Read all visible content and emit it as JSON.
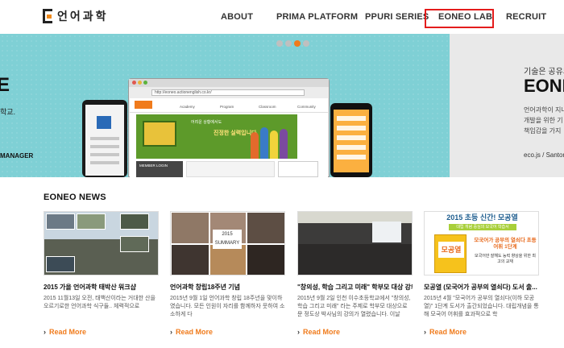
{
  "header": {
    "logo_text": "언어과학",
    "nav": [
      {
        "label": "ABOUT"
      },
      {
        "label": "PRIMA PLATFORM"
      },
      {
        "label": "PPURI SERIES"
      },
      {
        "label": "EONEO LAB"
      },
      {
        "label": "RECRUIT"
      }
    ],
    "active_nav": "EONEO LAB",
    "highlight_color": "#e41c1c"
  },
  "hero": {
    "left_big": "E",
    "left_small": "학교.",
    "left_manager": "MANAGER",
    "right_kicker": "기술은 공유되",
    "right_big": "EONE",
    "right_desc": [
      "언어과학이 지니",
      "개발을 위한 기",
      "책임감을 가지"
    ],
    "right_foot": "eco.js / Santori",
    "browser_url": "http://eoneo.actionenglish.co.kr/",
    "site_logo": "Action English",
    "site_tabs": [
      "Academy",
      "Program",
      "Classroom",
      "Community"
    ],
    "site_banner_text": "어려운 상황에서도",
    "site_banner_big": "진정한 실력입니다.",
    "member_login": "MEMBER LOGIN",
    "slide_dots": 4,
    "active_dot": 2,
    "accent_color": "#f07b1c",
    "bg_color": "#7fd0d5"
  },
  "news": {
    "title": "EONEO NEWS",
    "read_more": "Read More",
    "items": [
      {
        "title": "2015 가을 언어과학 태박산 워크샵",
        "desc": "2015 11월13일 오전, 태백산이라는 거대한 산을 오르기로한 언어과학 식구들.. 체력적으로"
      },
      {
        "title": "언어과학 창립18주년 기념",
        "desc": "2015년 9월 1일 언어과학 창립 18주년을 맞이하였습니다. 모든 인원이 자리를 함께하자 뭇하여 소소하게 다",
        "badge": "2015 SUMMARY"
      },
      {
        "title": "\"창의성, 학습 그리고 미래\" 학부모 대상 강의",
        "desc": "2015년 9월 2일 인천 이수초등학교에서 \"창의성, 학습 그리고 미래\" 라는 주제로 학부모 대상으로 문 정도상 박사님의 강의가 열렸습니다. 이날"
      },
      {
        "title": "모공열 (모국어가 공부의 열쇠다) 도서 출...",
        "desc": "2015년 4월 \"모국어가 공부의 열쇠다(이하 모공열)\" 1단계 도서가 출간되었습니다. 대립개념을 통해 모국어 어휘를 효과적으로 학",
        "thumb_title": "2015 초등 신간! 모공열",
        "thumb_sub": "대립 개념 중심의 모국어 학습서",
        "thumb_book": "모공열",
        "thumb_text1": "모국어가 공부의 열쇠다 초등 어휘 1단계",
        "thumb_text2": "모국어만 잘해도 능력 향상을 위한 최고의 교재"
      }
    ]
  }
}
